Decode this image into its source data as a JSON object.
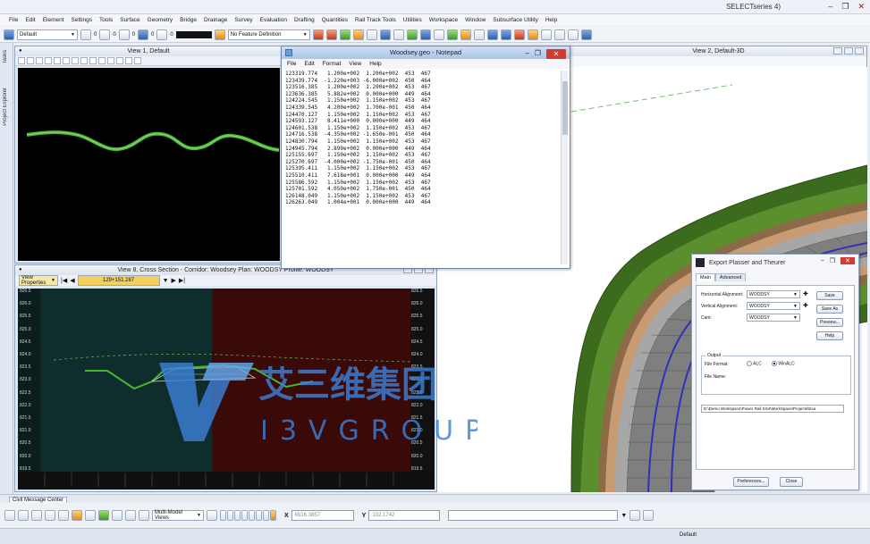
{
  "app": {
    "title": "SELECTseries 4)"
  },
  "menu": [
    "File",
    "Edit",
    "Element",
    "Settings",
    "Tools",
    "Surface",
    "Geometry",
    "Bridge",
    "Drainage",
    "Survey",
    "Evaluation",
    "Drafting",
    "Quantities",
    "Rail Track Tools",
    "Utilities",
    "Workspace",
    "Window",
    "Subsurface Utility",
    "Help"
  ],
  "toolbar": {
    "level_combo": "Default",
    "num1": "0",
    "num2": "0",
    "num3": "0",
    "num4": "0",
    "num5": "0",
    "feature_def": "No Feature Definition"
  },
  "left_strip": {
    "tasks": "Tasks",
    "explorer": "Project Explorer"
  },
  "view1": {
    "title": "View 1, Default"
  },
  "view2": {
    "title": "View 2, Default-3D"
  },
  "view8": {
    "title": "View 8, Cross Section - Corridor: Woodsey Plan: WOODSY Profile: WOODSY",
    "view_properties": "View Properties",
    "station": "129+151.287",
    "left_axis": [
      "826.5",
      "826.0",
      "825.5",
      "825.0",
      "824.5",
      "824.0",
      "823.5",
      "823.0",
      "822.5",
      "822.0",
      "821.5",
      "821.0",
      "820.5",
      "820.0",
      "819.5"
    ],
    "right_axis": [
      "826.5",
      "826.0",
      "825.5",
      "825.0",
      "824.5",
      "824.0",
      "823.5",
      "823.0",
      "822.5",
      "822.0",
      "821.5",
      "821.0",
      "820.5",
      "820.0",
      "819.5"
    ]
  },
  "notepad": {
    "title": "Woodsey.geo - Notepad",
    "menu": [
      "File",
      "Edit",
      "Format",
      "View",
      "Help"
    ],
    "lines": [
      "123319.774   1.200e+002  1.200e+002  453  467",
      "123439.774  -1.220e+003 -6.000e+002  450  464",
      "123516.385   1.200e+002  1.200e+002  453  467",
      "123636.385   5.882e+002  0.000e+000  449  464",
      "124224.545   1.150e+002  1.150e+002  453  467",
      "124339.545   4.200e+002  1.700e-001  450  464",
      "124470.127   1.150e+002  1.150e+002  453  467",
      "124593.127   8.411e+000  0.000e+000  449  464",
      "124601.538   1.150e+002  1.150e+002  453  467",
      "124716.538  -4.350e+002 -1.650e-001  450  464",
      "124830.794   1.150e+002  1.150e+002  453  467",
      "124945.794   2.899e+002  0.000e+000  449  464",
      "125155.697   1.150e+002  1.150e+002  453  467",
      "125270.697  -4.000e+002 -1.750e-001  450  464",
      "125395.411   1.150e+002  1.150e+002  453  467",
      "125510.411   7.618e+001  0.000e+000  449  464",
      "125586.592   1.150e+002  1.150e+002  453  467",
      "125701.592   4.050e+002  1.750e-001  450  464",
      "126148.049   1.150e+002  1.150e+002  453  467",
      "126263.049   1.004e+001  0.000e+000  449  464"
    ]
  },
  "dialog": {
    "title": "Export Plasser and Theurer",
    "tabs": [
      "Main",
      "Advanced"
    ],
    "horizontal_label": "Horizontal Alignment:",
    "horizontal_value": "WOODSY",
    "vertical_label": "Vertical Alignment:",
    "vertical_value": "WOODSY",
    "cant_label": "Cant:",
    "cant_value": "WOODSY",
    "save": "Save",
    "save_as": "Save As",
    "preview": "Preview...",
    "help": "Help",
    "output_label": "Output",
    "file_format_label": "File Format:",
    "opt_alc": "ALC",
    "opt_winalc": "WinALC",
    "file_name_label": "File Name:",
    "file_name_value": "D:\\Demo Workspace\\Power Rail SS4\\WorkSpace\\Projects\\Exa",
    "preferences": "Preferences...",
    "close": "Close"
  },
  "message_center": "Civil Message Center",
  "bottom": {
    "multi_model": "Multi-Model Views",
    "x_label": "X",
    "x_value": "6516.3857",
    "y_label": "Y",
    "y_value": "102.1742"
  },
  "status": {
    "default": "Default"
  },
  "watermark": {
    "cn": "艾三维集团",
    "en": "I3VGROUP"
  }
}
